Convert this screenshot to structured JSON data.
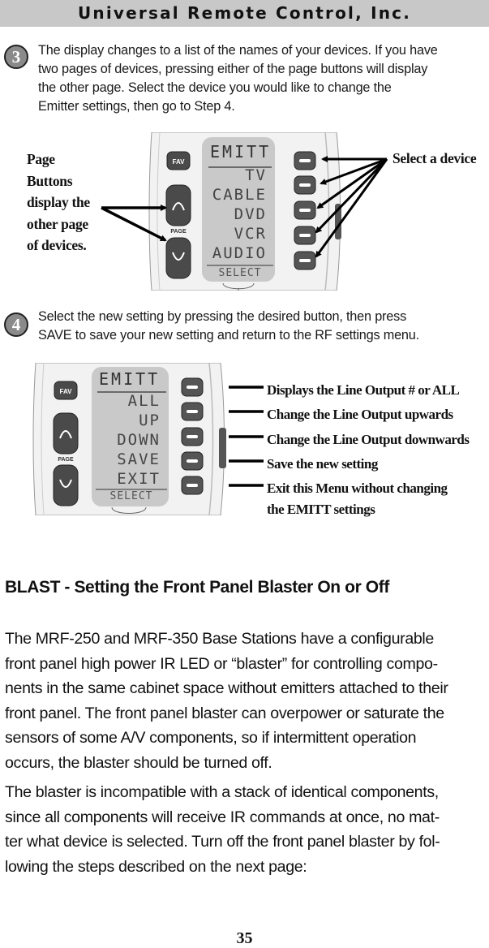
{
  "header": {
    "title": "Universal Remote Control, Inc."
  },
  "step3": {
    "number": "3",
    "lines": [
      "The display changes to a list of the names of your devices. If you have",
      "two pages of devices, pressing either of the page buttons will display",
      "the other page. Select the device you would like to change the",
      "Emitter settings, then go to Step 4."
    ],
    "callout_left": [
      "Page",
      "Buttons",
      "display the",
      "other page",
      "of devices."
    ],
    "callout_right": "Select a device",
    "remote": {
      "fav_label": "FAV",
      "page_label": "PAGE",
      "lcd_title": "EMITT",
      "lcd_items": [
        "TV",
        "CABLE",
        "DVD",
        "VCR",
        "AUDIO"
      ],
      "lcd_footer": "SELECT"
    }
  },
  "step4": {
    "number": "4",
    "lines": [
      "Select the new setting by pressing the desired button, then press",
      "SAVE to save your new setting and return to the RF settings menu."
    ],
    "callouts": [
      "Displays the Line Output # or ALL",
      "Change the Line Output upwards",
      "Change the Line Output downwards",
      "Save the new setting",
      "Exit this Menu without changing",
      "the EMITT settings"
    ],
    "remote": {
      "fav_label": "FAV",
      "page_label": "PAGE",
      "lcd_title": "EMITT",
      "lcd_items": [
        "ALL",
        "UP",
        "DOWN",
        "SAVE",
        "EXIT"
      ],
      "lcd_footer": "SELECT"
    }
  },
  "blast": {
    "title": "BLAST - Setting the Front Panel Blaster On or Off",
    "para1": [
      "The MRF-250 and MRF-350 Base Stations have a configurable",
      "front panel high power IR LED or “blaster” for controlling compo-",
      "nents in the same cabinet space without emitters attached to their",
      "front panel. The front panel blaster can overpower or saturate the",
      "sensors of some A/V components, so if intermittent operation",
      "occurs, the blaster should be turned off."
    ],
    "para2": [
      "The blaster is incompatible with a stack of identical components,",
      "since all components will receive IR commands at once, no mat-",
      "ter what device is selected. Turn off the front panel blaster by fol-",
      "lowing the steps described on the next page:"
    ]
  },
  "footer": {
    "page_number": "35"
  },
  "colors": {
    "header_bg": "#c8c8c8",
    "lcd_bg": "#c9c9c9",
    "button_dark": "#4a4a4a",
    "step_circle": "#8a8a8a"
  }
}
